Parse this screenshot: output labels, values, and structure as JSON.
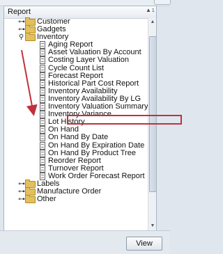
{
  "header": {
    "column_label": "Report",
    "sort_indicator": "▲",
    "sort_index": "1"
  },
  "tree": [
    {
      "label": "Customer",
      "type": "folder",
      "state": "collapsed",
      "level": 0
    },
    {
      "label": "Gadgets",
      "type": "folder",
      "state": "collapsed",
      "level": 0
    },
    {
      "label": "Inventory",
      "type": "folder",
      "state": "expanded",
      "level": 0
    },
    {
      "label": "Aging Report",
      "type": "report",
      "level": 1
    },
    {
      "label": "Asset Valuation By Account",
      "type": "report",
      "level": 1
    },
    {
      "label": "Costing Layer Valuation",
      "type": "report",
      "level": 1
    },
    {
      "label": "Cycle Count List",
      "type": "report",
      "level": 1
    },
    {
      "label": "Forecast Report",
      "type": "report",
      "level": 1
    },
    {
      "label": "Historical Part Cost Report",
      "type": "report",
      "level": 1
    },
    {
      "label": "Inventory Availability",
      "type": "report",
      "level": 1
    },
    {
      "label": "Inventory Availability By LG",
      "type": "report",
      "level": 1
    },
    {
      "label": "Inventory Valuation Summary",
      "type": "report",
      "level": 1,
      "highlighted": true
    },
    {
      "label": "Inventory Variance",
      "type": "report",
      "level": 1
    },
    {
      "label": "Lot History",
      "type": "report",
      "level": 1
    },
    {
      "label": "On Hand",
      "type": "report",
      "level": 1
    },
    {
      "label": "On Hand By Date",
      "type": "report",
      "level": 1
    },
    {
      "label": "On Hand By Expiration Date",
      "type": "report",
      "level": 1
    },
    {
      "label": "On Hand By Product Tree",
      "type": "report",
      "level": 1
    },
    {
      "label": "Reorder Report",
      "type": "report",
      "level": 1
    },
    {
      "label": "Turnover Report",
      "type": "report",
      "level": 1
    },
    {
      "label": "Work Order Forecast Report",
      "type": "report",
      "level": 1
    },
    {
      "label": "Labels",
      "type": "folder",
      "state": "collapsed",
      "level": 0
    },
    {
      "label": "Manufacture Order",
      "type": "folder",
      "state": "collapsed",
      "level": 0
    },
    {
      "label": "Other",
      "type": "folder",
      "state": "collapsed",
      "level": 0
    }
  ],
  "buttons": {
    "view_label": "View"
  },
  "colors": {
    "highlight_border": "#c0313b",
    "folder": "#e2c05c",
    "arrow": "#c0313b"
  }
}
